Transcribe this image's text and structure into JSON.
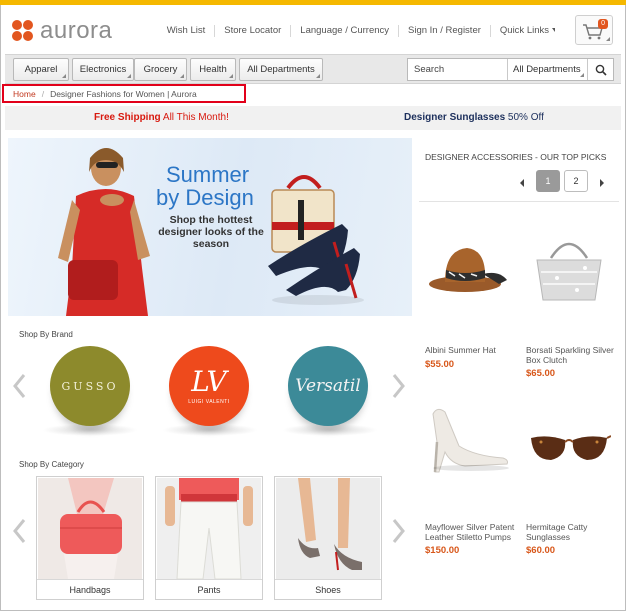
{
  "brand": {
    "name": "aurora",
    "colors": {
      "accent": "#f5b800",
      "logo": "#e2561f",
      "price": "#d8571a",
      "alert_red": "#e2001a"
    }
  },
  "header": {
    "utility_links": [
      "Wish List",
      "Store Locator",
      "Language / Currency",
      "Sign In / Register",
      "Quick Links"
    ],
    "cart_count": "0"
  },
  "nav": {
    "categories": [
      "Apparel",
      "Electronics",
      "Grocery",
      "Health",
      "All Departments"
    ],
    "search_placeholder": "Search",
    "search_department": "All Departments"
  },
  "breadcrumb": {
    "home": "Home",
    "current": "Designer Fashions for Women | Aurora"
  },
  "promo": {
    "left_strong": "Free Shipping",
    "left_rest": " All This Month!",
    "right_strong": "Designer Sunglasses",
    "right_rest": " 50% Off"
  },
  "hero": {
    "title_line1": "Summer",
    "title_line2": "by Design",
    "subtitle": "Shop the hottest designer looks of the season"
  },
  "shop_by_brand": {
    "label": "Shop By Brand",
    "brands": [
      {
        "name": "GUSSO",
        "color": "#8d8a2c"
      },
      {
        "name": "LV",
        "subtext": "LUIGI VALENTI",
        "color": "#ee4a1c"
      },
      {
        "name": "Versatil",
        "color": "#3c8a98"
      }
    ]
  },
  "shop_by_category": {
    "label": "Shop By Category",
    "categories": [
      "Handbags",
      "Pants",
      "Shoes"
    ]
  },
  "top_picks": {
    "title": "DESIGNER ACCESSORIES - OUR TOP PICKS",
    "pages": [
      "1",
      "2"
    ],
    "current_page": 1,
    "products": [
      {
        "name": "Albini Summer Hat",
        "price": "$55.00"
      },
      {
        "name": "Borsati Sparkling Silver Box Clutch",
        "price": "$65.00"
      },
      {
        "name": "Mayflower Silver Patent Leather Stiletto Pumps",
        "price": "$150.00"
      },
      {
        "name": "Hermitage Catty Sunglasses",
        "price": "$60.00"
      }
    ]
  },
  "icons": [
    "logo-icon",
    "cart-icon",
    "search-icon",
    "chevron-left-icon",
    "chevron-right-icon"
  ]
}
